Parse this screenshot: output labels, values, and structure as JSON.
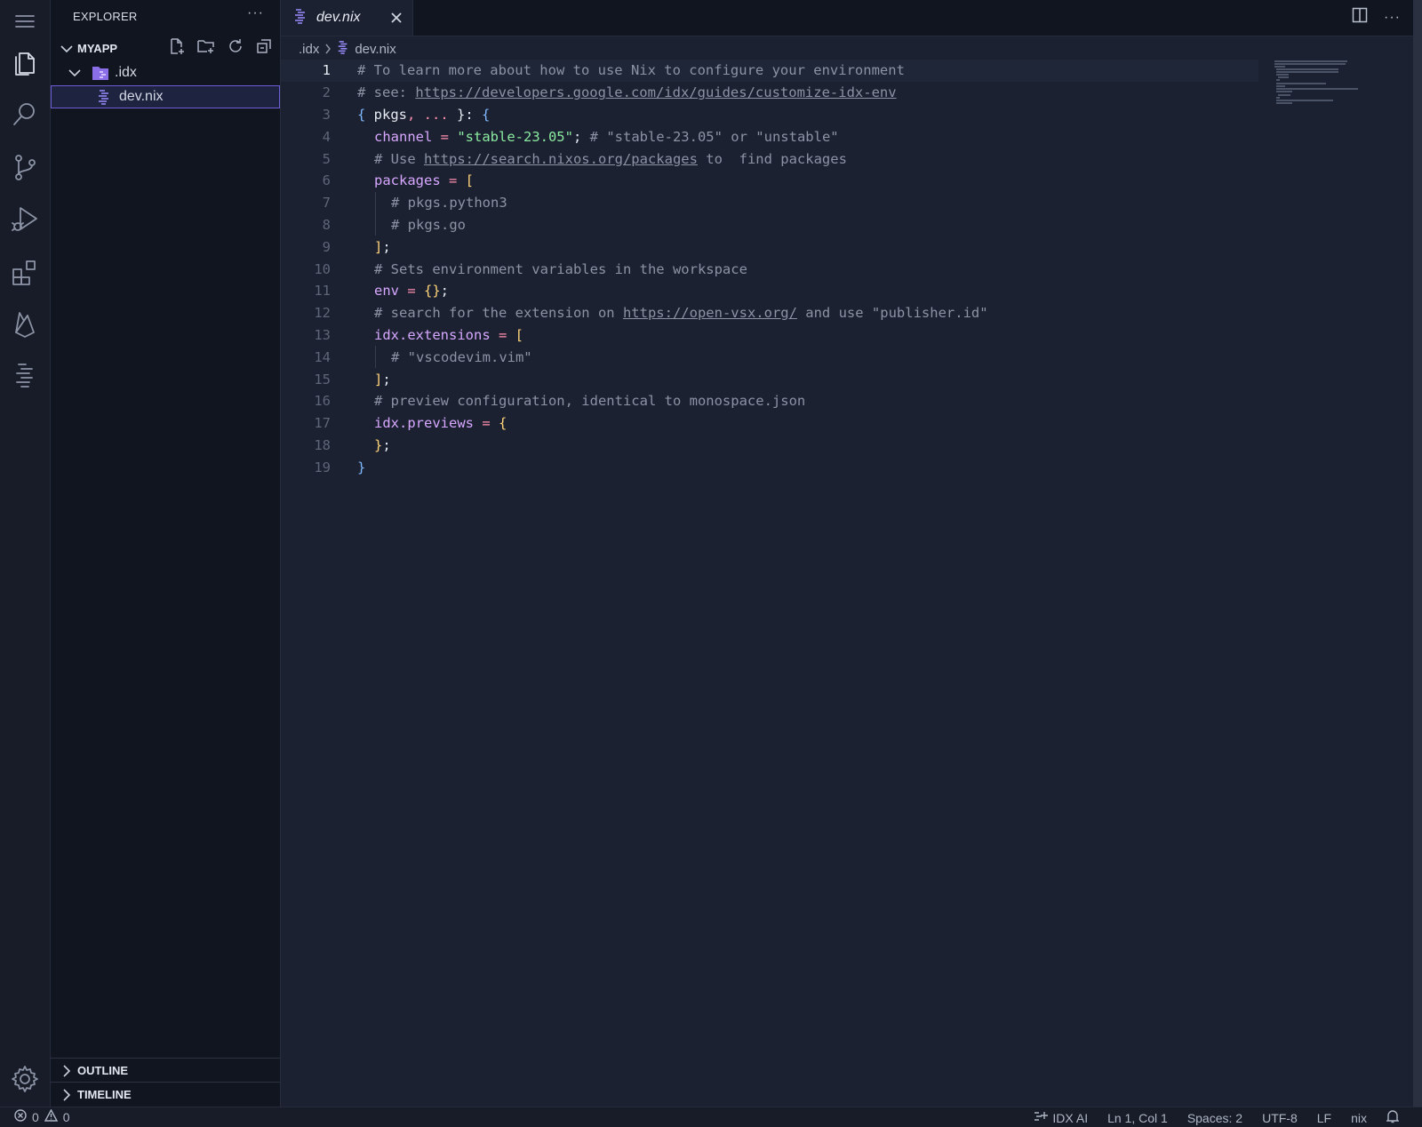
{
  "sidebar": {
    "title": "EXPLORER",
    "more": "···",
    "project": "MYAPP",
    "folder": ".idx",
    "file": "dev.nix",
    "outline": "OUTLINE",
    "timeline": "TIMELINE"
  },
  "tab": {
    "label": "dev.nix"
  },
  "breadcrumb": {
    "folder": ".idx",
    "file": "dev.nix"
  },
  "editor": {
    "more": "···",
    "line_numbers": [
      "1",
      "2",
      "3",
      "4",
      "5",
      "6",
      "7",
      "8",
      "9",
      "10",
      "11",
      "12",
      "13",
      "14",
      "15",
      "16",
      "17",
      "18",
      "19"
    ],
    "lines": {
      "l1": "# To learn more about how to use Nix to configure your environment",
      "l2_pre": "# see: ",
      "l2_url": "https://developers.google.com/idx/guides/customize-idx-env",
      "l3_a": "{",
      "l3_b": " pkgs",
      "l3_c": ", ...",
      "l3_d": " }: ",
      "l3_e": "{",
      "l4_key": "channel",
      "l4_eq": " = ",
      "l4_val": "\"stable-23.05\"",
      "l4_semi": "; ",
      "l4_com": "# \"stable-23.05\" or \"unstable\"",
      "l5_pre": "# Use ",
      "l5_url": "https://search.nixos.org/packages",
      "l5_post": " to  find packages",
      "l6_key": "packages",
      "l6_eq": " = ",
      "l6_br": "[",
      "l7": "# pkgs.python3",
      "l8": "# pkgs.go",
      "l9_br": "]",
      "l9_semi": ";",
      "l10": "# Sets environment variables in the workspace",
      "l11_key": "env",
      "l11_eq": " = ",
      "l11_br": "{}",
      "l11_semi": ";",
      "l12_pre": "# search for the extension on ",
      "l12_url": "https://open-vsx.org/",
      "l12_post": " and use \"publisher.id\"",
      "l13_key": "idx.extensions",
      "l13_eq": " = ",
      "l13_br": "[",
      "l14": "# \"vscodevim.vim\"",
      "l15_br": "]",
      "l15_semi": ";",
      "l16": "# preview configuration, identical to monospace.json",
      "l17_key": "idx.previews",
      "l17_eq": " = ",
      "l17_br": "{",
      "l18_br": "}",
      "l18_semi": ";",
      "l19": "}"
    }
  },
  "status": {
    "errors": "0",
    "warnings": "0",
    "ai": "IDX AI",
    "position": "Ln 1, Col 1",
    "spaces": "Spaces: 2",
    "encoding": "UTF-8",
    "eol": "LF",
    "language": "nix"
  }
}
